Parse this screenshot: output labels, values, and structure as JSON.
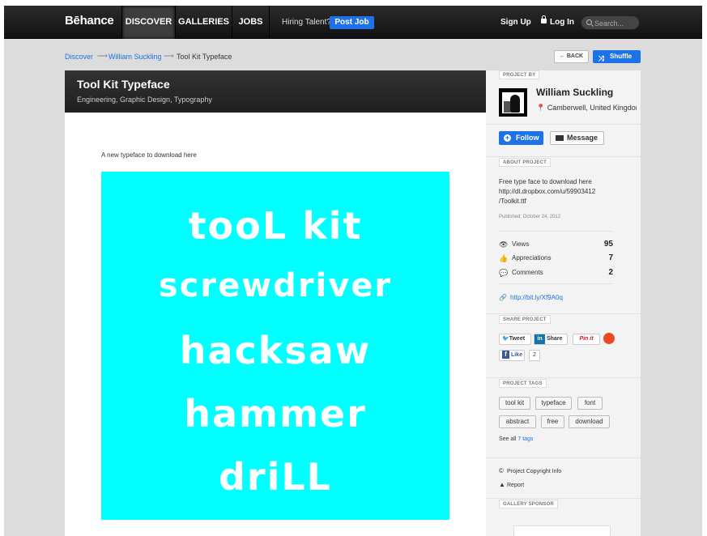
{
  "nav": {
    "logo": "Bēhance",
    "tabs": [
      {
        "label": "DISCOVER"
      },
      {
        "label": "GALLERIES"
      },
      {
        "label": "JOBS"
      }
    ],
    "hiring_text": "Hiring Talent?",
    "post_job": "Post Job",
    "sign_up": "Sign Up",
    "log_in": "Log In",
    "search_placeholder": "Search..."
  },
  "breadcrumb": {
    "items": [
      "Discover",
      "William Suckling",
      "Tool Kit Typeface"
    ],
    "separator": "⟶"
  },
  "actions": {
    "back": "← BACK",
    "shuffle": "Shuffle"
  },
  "project": {
    "title": "Tool Kit Typeface",
    "fields": "Engineering, Graphic Design, Typography",
    "description": "A new typeface to download here",
    "artwork": {
      "background": "#00ffff",
      "lines": [
        "tooL kit",
        "screwdriver",
        "hacksaw",
        "hammer",
        "driLL"
      ]
    }
  },
  "sidebar": {
    "project_by_label": "PROJECT BY",
    "author_name": "William Suckling",
    "author_location": "Camberwell, United Kingdom",
    "follow": "Follow",
    "message": "Message",
    "about_label": "ABOUT PROJECT",
    "about_lines": [
      "Free type face to download here",
      "http://dl.dropbox.com/u/59903412",
      "/Toolkit.ttf"
    ],
    "published": "Published: October 24, 2012",
    "stats": [
      {
        "icon": "eye-icon",
        "label": "Views",
        "value": "95"
      },
      {
        "icon": "thumbs-up-icon",
        "label": "Appreciations",
        "value": "7"
      },
      {
        "icon": "comment-icon",
        "label": "Comments",
        "value": "2"
      }
    ],
    "short_link": "http://bit.ly/Xf9A0q",
    "share_label": "SHARE PROJECT",
    "share": {
      "tweet": "Tweet",
      "linkedin": "Share",
      "pinterest": "Pin it",
      "facebook": "Like",
      "facebook_count": "2"
    },
    "tags_label": "PROJECT TAGS",
    "tags": [
      "tool kit",
      "typeface",
      "font",
      "abstract",
      "free",
      "download"
    ],
    "see_all_prefix": "See all",
    "see_all_link": "7 tags",
    "copyright": "Project Copyright Info",
    "report": "Report",
    "sponsor_label": "GALLERY SPONSOR"
  },
  "colors": {
    "accent": "#1e72e8",
    "artwork_bg": "#00ffff",
    "nav_bg": "#1a1a1a"
  }
}
